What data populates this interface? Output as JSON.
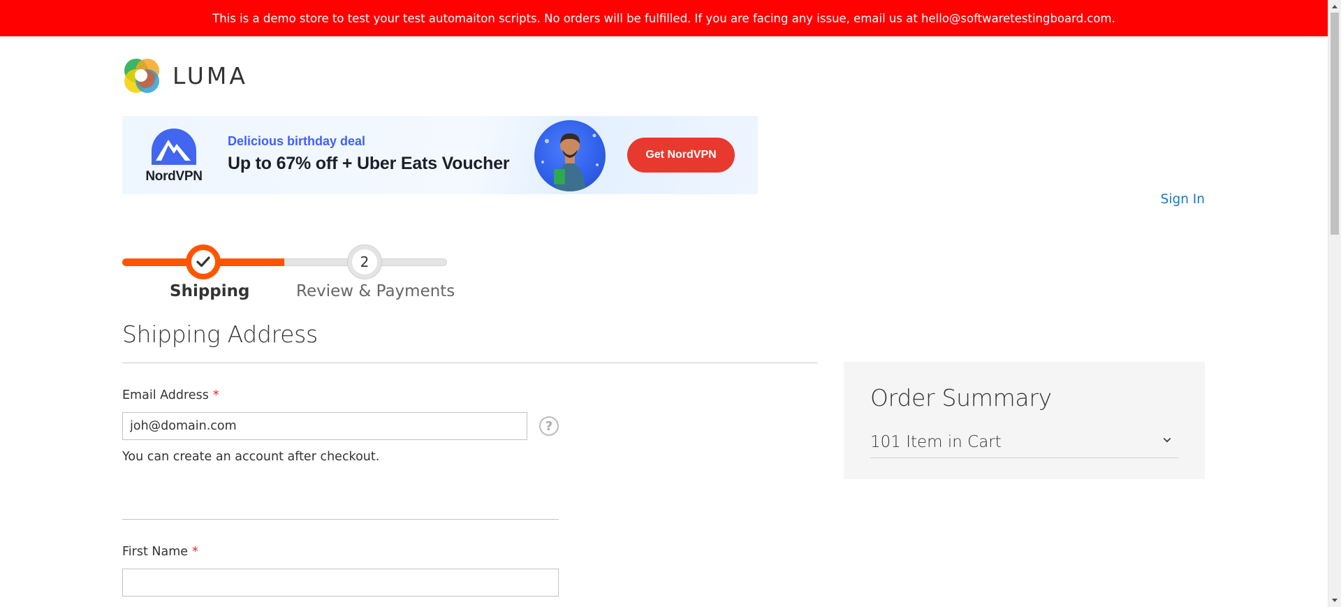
{
  "demo_notice": "This is a demo store to test your test automaiton scripts. No orders will be fulfilled. If you are facing any issue, email us at hello@softwaretestingboard.com.",
  "logo": {
    "text": "LUMA",
    "icon": "luma-logo-icon"
  },
  "ad": {
    "brand": "NordVPN",
    "brand_icon": "nordvpn-mountain-icon",
    "tagline": "Delicious birthday deal",
    "headline": "Up to 67% off + Uber Eats Voucher",
    "cta": "Get NordVPN",
    "colors": {
      "tagline": "#3e5fff",
      "cta": "#e8392f"
    }
  },
  "header": {
    "sign_in": "Sign In"
  },
  "progress": {
    "steps": [
      {
        "label": "Shipping",
        "state": "complete",
        "icon": "checkmark-icon"
      },
      {
        "label": "Review & Payments",
        "number": "2",
        "state": "upcoming"
      }
    ],
    "accent": "#ff5501"
  },
  "shipping": {
    "title": "Shipping Address",
    "email": {
      "label": "Email Address",
      "required_mark": "*",
      "value": "joh@domain.com",
      "help_icon": "help-question-icon",
      "note": "You can create an account after checkout."
    },
    "first_name": {
      "label": "First Name",
      "required_mark": "*",
      "value": ""
    }
  },
  "summary": {
    "title": "Order Summary",
    "items_text": "101 Item in Cart",
    "toggle_icon": "chevron-down-icon"
  },
  "colors": {
    "notice_bg": "#ff0101",
    "link": "#1979c3",
    "required": "#e02b27"
  }
}
